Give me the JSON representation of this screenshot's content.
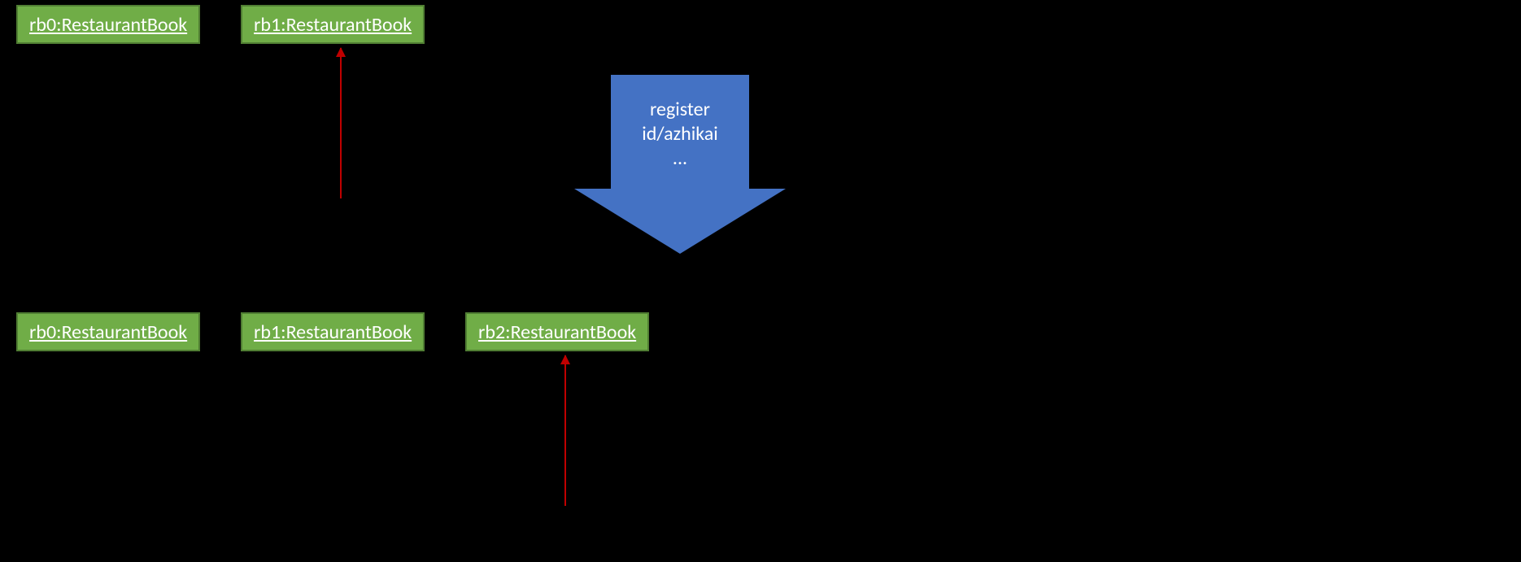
{
  "top_row": {
    "items": [
      {
        "label": "rb0:RestaurantBook"
      },
      {
        "label": "rb1:RestaurantBook"
      }
    ]
  },
  "bottom_row": {
    "items": [
      {
        "label": "rb0:RestaurantBook"
      },
      {
        "label": "rb1:RestaurantBook"
      },
      {
        "label": "rb2:RestaurantBook"
      }
    ]
  },
  "action_arrow": {
    "line1": "register",
    "line2": "id/azhikai",
    "line3": "..."
  }
}
